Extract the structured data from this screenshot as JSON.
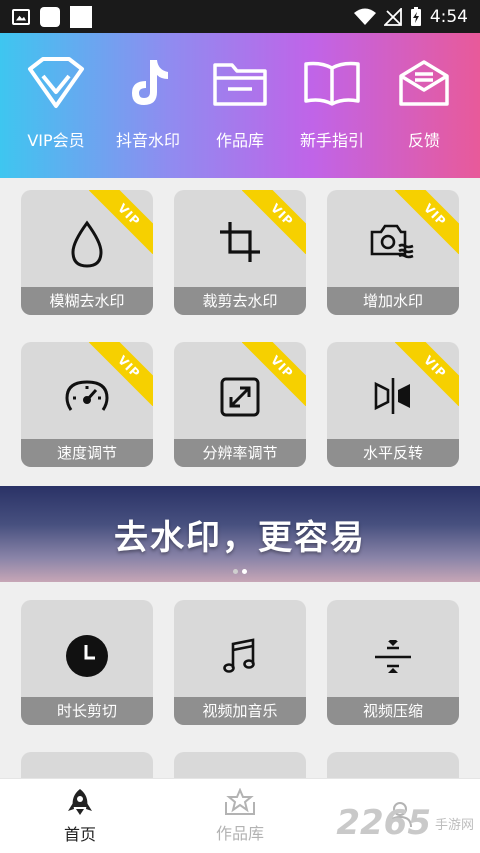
{
  "status_bar": {
    "time": "4:54"
  },
  "header": {
    "items": [
      {
        "label": "VIP会员",
        "icon": "diamond-icon"
      },
      {
        "label": "抖音水印",
        "icon": "tiktok-icon"
      },
      {
        "label": "作品库",
        "icon": "folder-icon"
      },
      {
        "label": "新手指引",
        "icon": "book-icon"
      },
      {
        "label": "反馈",
        "icon": "mail-icon"
      }
    ]
  },
  "vip_badge": "VIP",
  "tools_row1": [
    {
      "label": "模糊去水印",
      "icon": "drop-icon",
      "vip": true
    },
    {
      "label": "裁剪去水印",
      "icon": "crop-icon",
      "vip": true
    },
    {
      "label": "增加水印",
      "icon": "camera-wave-icon",
      "vip": true
    }
  ],
  "tools_row2": [
    {
      "label": "速度调节",
      "icon": "speedometer-icon",
      "vip": true
    },
    {
      "label": "分辨率调节",
      "icon": "expand-icon",
      "vip": true
    },
    {
      "label": "水平反转",
      "icon": "flip-horizontal-icon",
      "vip": true
    }
  ],
  "banner": {
    "text": "去水印，更容易",
    "slides": 2,
    "active_slide": 2
  },
  "tools_row3": [
    {
      "label": "时长剪切",
      "icon": "clock-icon"
    },
    {
      "label": "视频加音乐",
      "icon": "music-note-icon"
    },
    {
      "label": "视频压缩",
      "icon": "compress-icon"
    }
  ],
  "tabbar": {
    "tabs": [
      {
        "label": "首页",
        "icon": "rocket-icon",
        "active": true
      },
      {
        "label": "作品库",
        "icon": "star-box-icon",
        "active": false
      },
      {
        "label": "",
        "icon": "person-icon",
        "active": false
      }
    ]
  },
  "watermark": {
    "number": "2265",
    "text": "手游网"
  },
  "colors": {
    "vip_ribbon": "#f6d000",
    "tile_bg": "#d9d9d9",
    "tile_label_bg": "#8f8f8f"
  }
}
